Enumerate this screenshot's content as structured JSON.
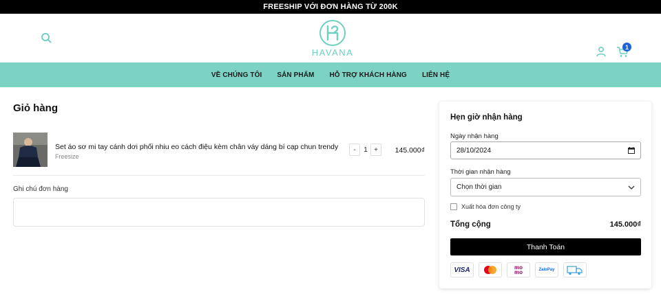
{
  "announcement": "FREESHIP VỚI ĐƠN HÀNG TỪ 200K",
  "brand": {
    "name": "HAVANA",
    "color": "#6fcfc0"
  },
  "header": {
    "cart_count": "1"
  },
  "colors": {
    "nav_bg": "#7dd3c3",
    "badge": "#1d63d8"
  },
  "nav": {
    "items": [
      "VỀ CHÚNG TÔI",
      "SẢN PHẨM",
      "HỖ TRỢ KHÁCH HÀNG",
      "LIÊN HỆ"
    ]
  },
  "cart": {
    "title": "Giỏ hàng",
    "items": [
      {
        "name": "Set áo sơ mi tay cánh dơi phối nhiu eo cách điệu kèm chân váy dáng bí cạp chun trendy",
        "variant": "Freesize",
        "quantity": "1",
        "minus": "-",
        "plus": "+",
        "price": "145.000₫"
      }
    ],
    "note_label": "Ghi chú đơn hàng"
  },
  "delivery": {
    "title": "Hẹn giờ nhận hàng",
    "date_label": "Ngày nhận hàng",
    "date_value": "28/10/2024",
    "time_label": "Thời gian nhận hàng",
    "time_value": "Chọn thời gian",
    "invoice_label": "Xuất hóa đơn công ty",
    "total_label": "Tổng cộng",
    "total_value": "145.000₫",
    "checkout_label": "Thanh Toán"
  },
  "payments": {
    "visa": "VISA",
    "mastercard_icon": "mastercard-icon",
    "momo": "mo mo",
    "zalopay": "ZaloPay",
    "cod_icon": "cod-truck-icon"
  }
}
